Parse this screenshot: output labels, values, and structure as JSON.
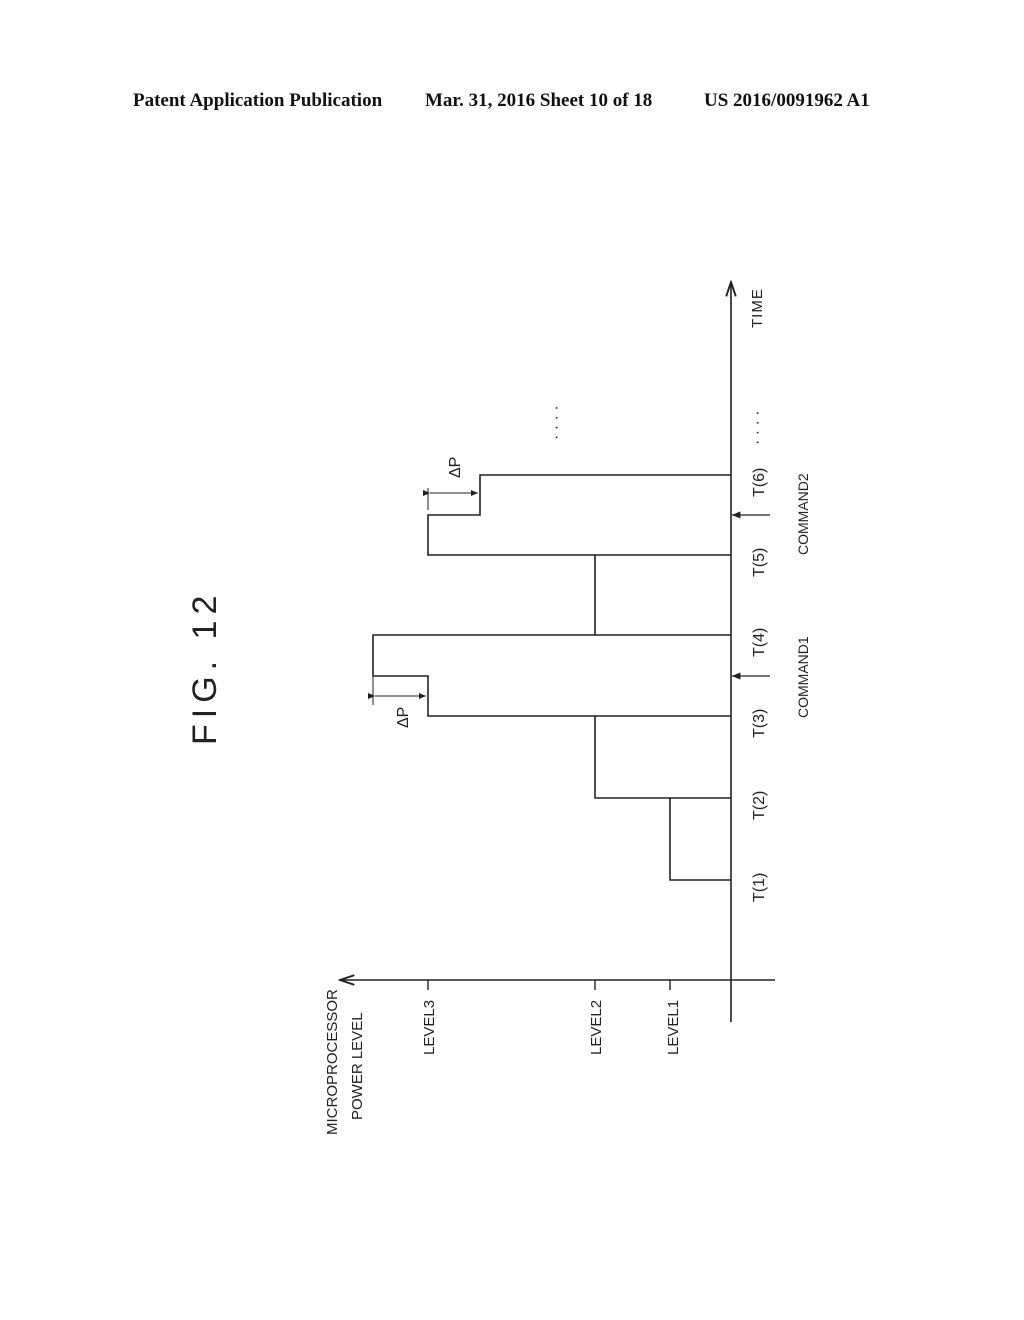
{
  "header": {
    "publication": "Patent Application Publication",
    "date_sheet": "Mar. 31, 2016  Sheet 10 of 18",
    "number": "US 2016/0091962 A1"
  },
  "figure": {
    "title": "FIG. 12",
    "y_axis_label_line1": "MICROPROCESSOR",
    "y_axis_label_line2": "POWER LEVEL",
    "x_axis_label": "TIME",
    "levels": [
      "LEVEL1",
      "LEVEL2",
      "LEVEL3"
    ],
    "times": [
      "T(1)",
      "T(2)",
      "T(3)",
      "T(4)",
      "T(5)",
      "T(6)"
    ],
    "commands": [
      "COMMAND1",
      "COMMAND2"
    ],
    "delta_label": "ΔP",
    "ellipsis": "· · · ·"
  },
  "chart_data": {
    "type": "line",
    "title": "FIG. 12",
    "xlabel": "TIME",
    "ylabel": "MICROPROCESSOR POWER LEVEL",
    "x_ticks": [
      "T(1)",
      "T(2)",
      "T(3)",
      "T(4)",
      "T(5)",
      "T(6)"
    ],
    "y_ticks": [
      "LEVEL1",
      "LEVEL2",
      "LEVEL3"
    ],
    "y_values": {
      "LEVEL1": 1,
      "LEVEL2": 2,
      "LEVEL3": 3,
      "DELTA_P": 0.33
    },
    "segments": [
      {
        "from": "T(1)",
        "to": "T(2)",
        "level": "LEVEL1"
      },
      {
        "from": "T(2)",
        "to": "T(3)",
        "level": "LEVEL2"
      },
      {
        "from": "T(3)",
        "to": "COMMAND1",
        "level": "LEVEL3"
      },
      {
        "from": "COMMAND1",
        "to": "T(4)",
        "level": "LEVEL3 + ΔP"
      },
      {
        "from": "T(4)",
        "to": "T(5)",
        "level": "LEVEL2"
      },
      {
        "from": "T(5)",
        "to": "COMMAND2",
        "level": "LEVEL3"
      },
      {
        "from": "COMMAND2",
        "to": "T(6)",
        "level": "LEVEL3 - ΔP"
      }
    ],
    "annotations": [
      "ΔP",
      "ΔP",
      "COMMAND1",
      "COMMAND2",
      "· · · ·"
    ],
    "orientation": "rotated-90-ccw"
  }
}
